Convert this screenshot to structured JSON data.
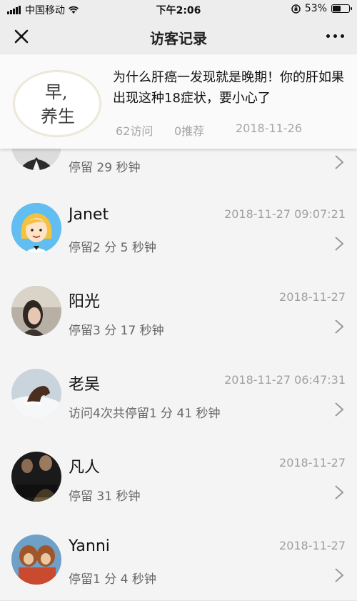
{
  "status_bar": {
    "carrier": "中国移动",
    "time": "下午2:06",
    "battery": "53%",
    "battery_level": 0.53
  },
  "nav": {
    "title": "访客记录",
    "close_icon": "close-icon",
    "more_icon": "more-icon"
  },
  "article": {
    "thumb_text_1": "早,",
    "thumb_text_2": "养生",
    "title": "为什么肝癌一发现就是晚期！你的肝如果出现这种18症状，要小心了",
    "visits": "62访问",
    "recommends": "0推荐",
    "date": "2018-11-26"
  },
  "visitors": [
    {
      "name": "",
      "time": "",
      "detail": "停留 29 秒钟"
    },
    {
      "name": "Janet",
      "time": "2018-11-27 09:07:21",
      "detail": "停留2 分 5 秒钟"
    },
    {
      "name": "阳光",
      "time": "2018-11-27",
      "detail": "停留3 分 17 秒钟"
    },
    {
      "name": "老吴",
      "time": "2018-11-27 06:47:31",
      "detail": "访问4次共停留1 分 41 秒钟"
    },
    {
      "name": "凡人",
      "time": "2018-11-27",
      "detail": "停留 31 秒钟"
    },
    {
      "name": "Yanni",
      "time": "2018-11-27",
      "detail": "停留1 分 4 秒钟"
    }
  ]
}
